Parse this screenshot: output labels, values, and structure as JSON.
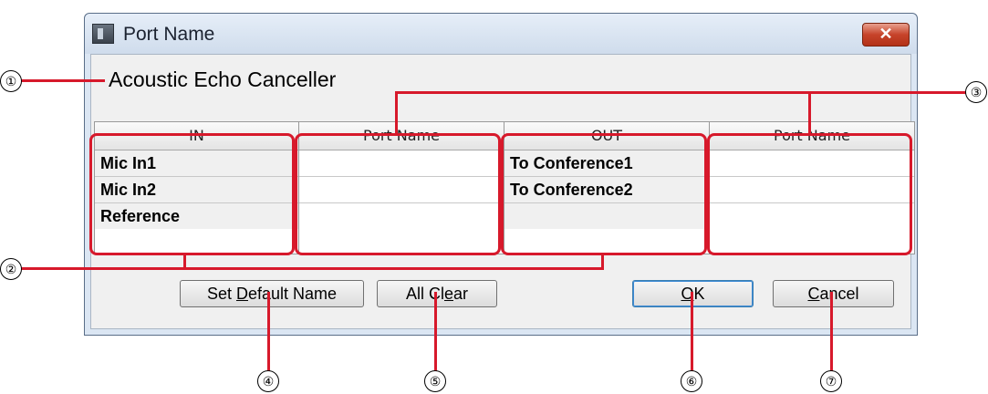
{
  "window": {
    "title": "Port Name",
    "close_glyph": "✕"
  },
  "component_name": "Acoustic Echo Canceller",
  "table": {
    "columns": [
      {
        "header": "IN",
        "cells": [
          "Mic In1",
          "Mic In2",
          "Reference"
        ]
      },
      {
        "header": "Port Name",
        "cells": [
          "",
          "",
          ""
        ]
      },
      {
        "header": "OUT",
        "cells": [
          "To Conference1",
          "To Conference2",
          ""
        ]
      },
      {
        "header": "Port Name",
        "cells": [
          "",
          "",
          ""
        ]
      }
    ]
  },
  "buttons": {
    "set_default": {
      "pre": "Set ",
      "key": "D",
      "post": "efault Name"
    },
    "all_clear": {
      "pre": "All Cl",
      "key": "e",
      "post": "ar"
    },
    "ok": {
      "pre": "",
      "key": "O",
      "post": "K"
    },
    "cancel": {
      "pre": "",
      "key": "C",
      "post": "ancel"
    }
  },
  "callouts": [
    "①",
    "②",
    "③",
    "④",
    "⑤",
    "⑥",
    "⑦"
  ],
  "colors": {
    "highlight": "#d7192b",
    "dialog_frame": "#dbe6f3",
    "close_button": "#c6432a"
  }
}
